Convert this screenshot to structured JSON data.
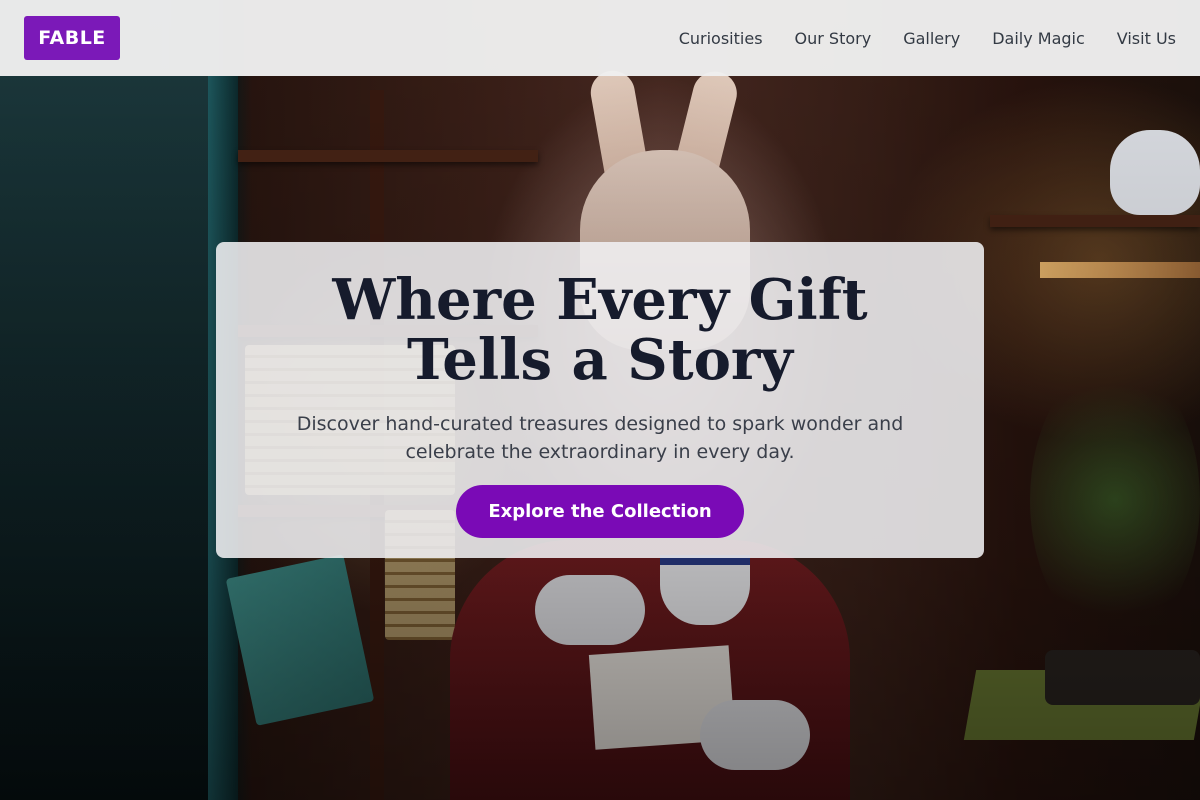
{
  "brand": {
    "name": "FABLE",
    "color": "#7b19b8"
  },
  "nav": {
    "items": [
      {
        "label": "Curiosities"
      },
      {
        "label": "Our Story"
      },
      {
        "label": "Gallery"
      },
      {
        "label": "Daily Magic"
      },
      {
        "label": "Visit Us"
      }
    ]
  },
  "hero": {
    "title": "Where Every Gift Tells a Story",
    "subtitle": "Discover hand-curated treasures designed to spark wonder and celebrate the extraordinary in every day.",
    "cta_label": "Explore the Collection",
    "cta_color": "#7a0ab6",
    "background_image": "white-rabbit-figure-in-gift-shop"
  }
}
